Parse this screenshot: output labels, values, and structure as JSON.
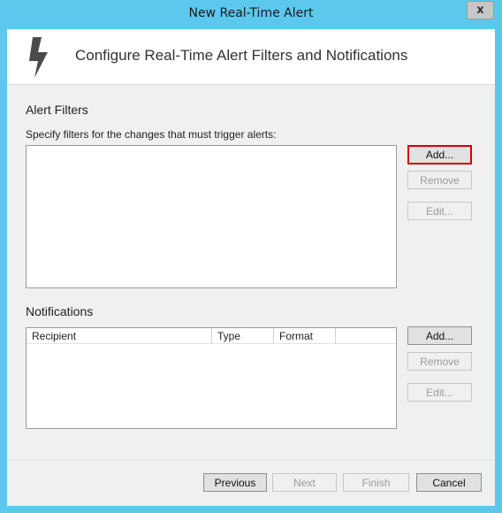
{
  "window": {
    "title": "New Real-Time Alert",
    "close_label": "x"
  },
  "header": {
    "title": "Configure Real-Time Alert Filters and Notifications",
    "icon": "lightning-bolt-icon"
  },
  "alert_filters": {
    "title": "Alert Filters",
    "instruction": "Specify filters for the changes that must trigger alerts:",
    "buttons": {
      "add": "Add...",
      "remove": "Remove",
      "edit": "Edit..."
    }
  },
  "notifications": {
    "title": "Notifications",
    "columns": [
      "Recipient",
      "Type",
      "Format"
    ],
    "buttons": {
      "add": "Add...",
      "remove": "Remove",
      "edit": "Edit..."
    }
  },
  "footer": {
    "previous": "Previous",
    "next": "Next",
    "finish": "Finish",
    "cancel": "Cancel"
  },
  "colors": {
    "title_bar": "#5cc8ee",
    "focus_outline": "#d60000"
  }
}
